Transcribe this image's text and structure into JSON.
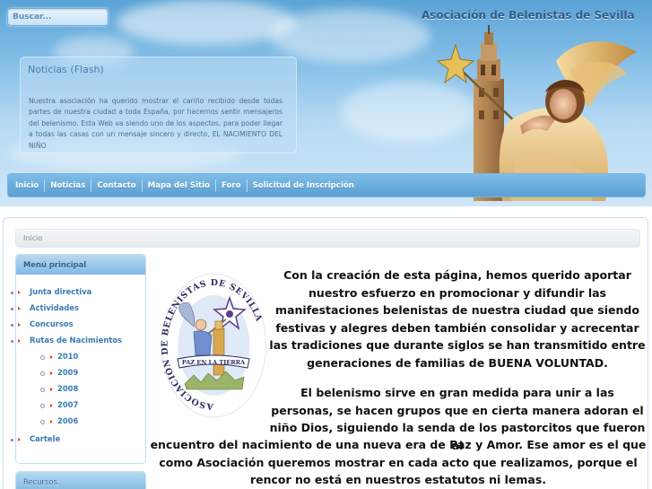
{
  "search": {
    "placeholder": "Buscar..."
  },
  "header": {
    "site_title": "Asociación de Belenistas de Sevilla"
  },
  "news": {
    "title": "Noticias (Flash)",
    "text": "Nuestra asociación ha querido mostrar el cariño recibido desde todas partes de nuestra ciudad a toda España, por hacernos sentir mensajeros del belenismo. Esta Web va siendo uno de los aspectos, para poder llegar a todas las casas con un mensaje sincero y directo, EL NACIMIENTO DEL NIÑO"
  },
  "nav": {
    "items": [
      {
        "label": "Inicio"
      },
      {
        "label": "Noticias"
      },
      {
        "label": "Contacto"
      },
      {
        "label": "Mapa del Sitio"
      },
      {
        "label": "Foro"
      },
      {
        "label": "Solicitud de Inscripción"
      }
    ]
  },
  "breadcrumb": {
    "current": "Inicio"
  },
  "main_menu": {
    "title": "Menú principal",
    "items": [
      {
        "label": "Junta directiva"
      },
      {
        "label": "Actividades"
      },
      {
        "label": "Concursos"
      },
      {
        "label": "Rutas de Nacimientos"
      },
      {
        "label": "Cartele"
      }
    ],
    "sub_items": [
      {
        "label": "2010"
      },
      {
        "label": "2009"
      },
      {
        "label": "2008"
      },
      {
        "label": "2007"
      },
      {
        "label": "2006"
      }
    ]
  },
  "resources_menu": {
    "title": "Recursos"
  },
  "seal": {
    "ring_text": "ASOCIACIÓN DE BELENISTAS DE SEVILLA",
    "banner": "PAZ EN LA TIERRA"
  },
  "article": {
    "p1": "Con la creación de esta página, hemos querido aportar nuestro esfuerzo en promocionar y difundir las manifestaciones belenistas de nuestra ciudad que siendo festivas y alegres deben también consolidar y acrecentar las tradiciones que durante siglos se han transmitido entre generaciones de familias de BUENA VOLUNTAD.",
    "p2_a": "El belenismo sirve en gran medida para unir a las personas, se hacen grupos que en cierta manera adoran el niño Dios, siguiendo la senda de los pastorcitos que fueron al",
    "p2_b": "encuentro del nacimiento de una nueva era de Paz y Amor. Ese amor es el que como Asociación queremos mostrar en cada acto que realizamos, porque el rencor no está en nuestros estatutos ni lemas."
  },
  "colors": {
    "nav_bg": "#5a9fd4",
    "link": "#3a79b3",
    "title": "#2f5b87",
    "bullet_arrow": "#d24b2a"
  }
}
